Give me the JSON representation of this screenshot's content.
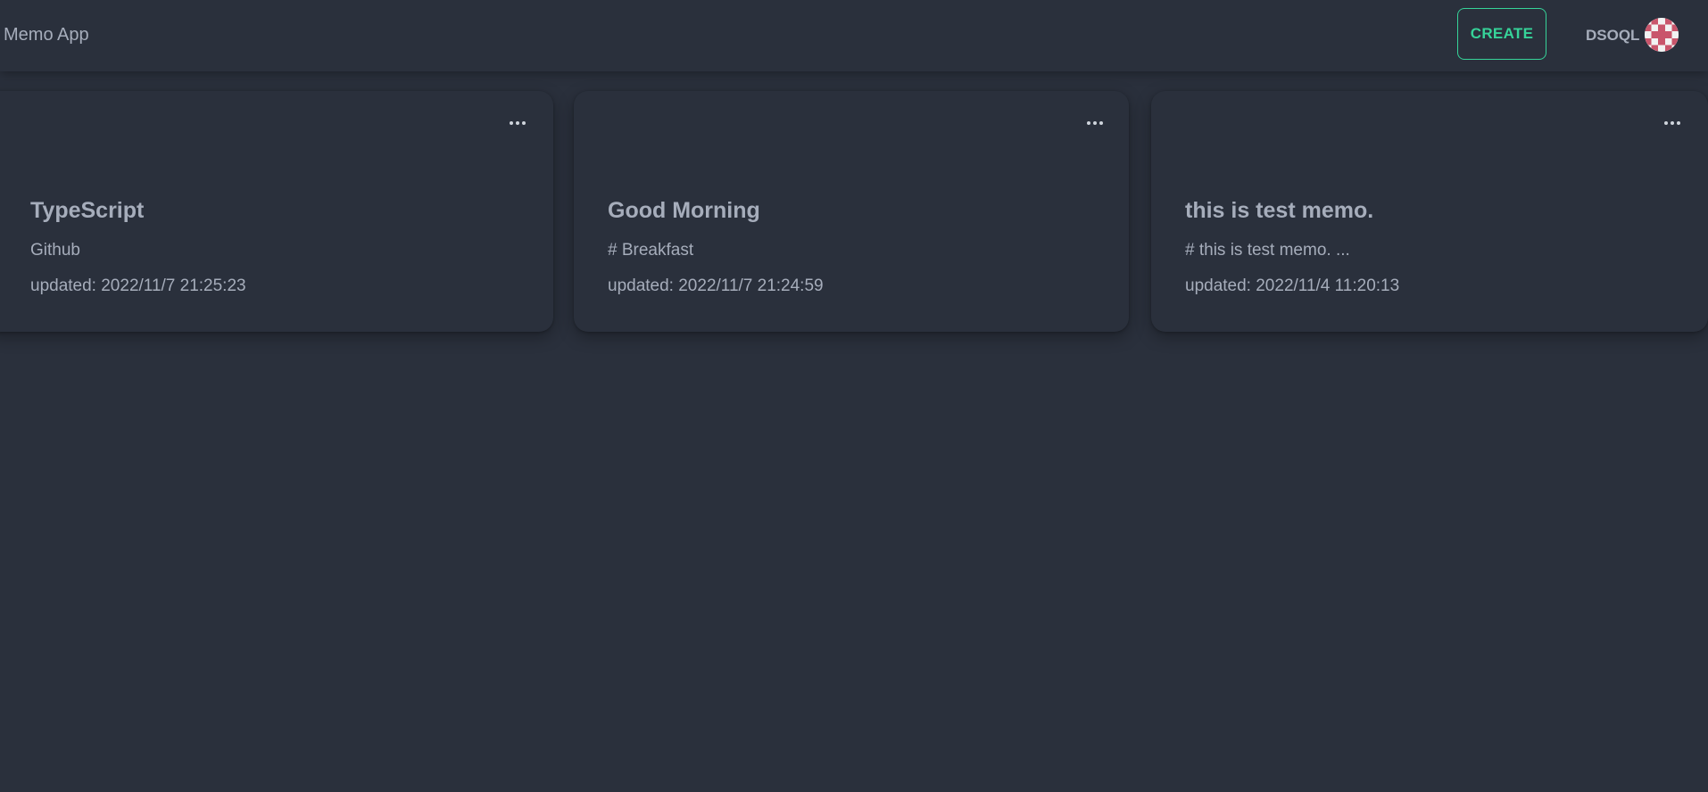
{
  "header": {
    "app_title": "Memo App",
    "create_label": "CREATE",
    "user_name": "DSOQL",
    "avatar_icon": "identicon-avatar"
  },
  "colors": {
    "background": "#2a303c",
    "text": "#a6adbb",
    "accent": "#36d399",
    "avatar": "#c9556b"
  },
  "memos": [
    {
      "title": "TypeScript",
      "body": "Github",
      "updated": "updated: 2022/11/7 21:25:23",
      "menu_icon": "more-horizontal-icon"
    },
    {
      "title": "Good Morning",
      "body": "# Breakfast",
      "updated": "updated: 2022/11/7 21:24:59",
      "menu_icon": "more-horizontal-icon"
    },
    {
      "title": "this is test memo.",
      "body": "# this is test memo. ...",
      "updated": "updated: 2022/11/4 11:20:13",
      "menu_icon": "more-horizontal-icon"
    }
  ]
}
